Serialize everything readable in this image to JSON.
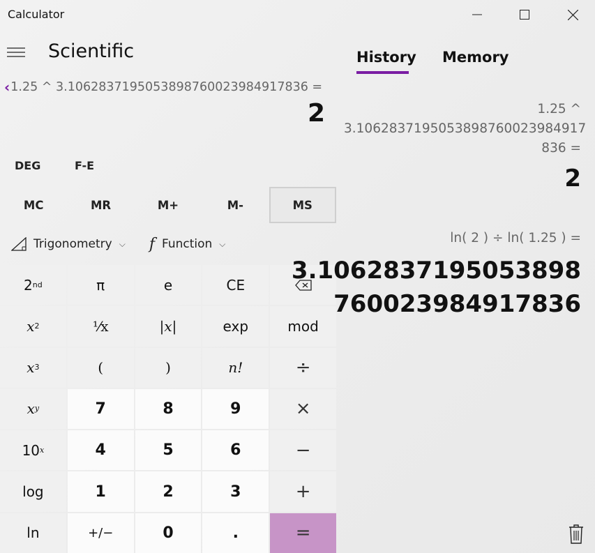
{
  "window": {
    "title": "Calculator"
  },
  "header": {
    "mode": "Scientific"
  },
  "display": {
    "expression": "1.25 ^ 3.1062837195053898760023984917836 =",
    "result": "2"
  },
  "toggles": {
    "angle": "DEG",
    "fe": "F-E"
  },
  "memory_row": [
    "MC",
    "MR",
    "M+",
    "M-",
    "MS"
  ],
  "function_row": {
    "trig_label": "Trigonometry",
    "func_label": "Function"
  },
  "keys": {
    "pi": "π",
    "e": "e",
    "ce": "CE",
    "reciprocal": "⅟x",
    "abs": "|x|",
    "exp": "exp",
    "mod": "mod",
    "lparen": "(",
    "rparen": ")",
    "factorial": "n!",
    "divide": "÷",
    "multiply": "×",
    "minus": "−",
    "plus": "+",
    "equals": "=",
    "log": "log",
    "ln": "ln",
    "negate": "+/−",
    "decimal": ".",
    "n7": "7",
    "n8": "8",
    "n9": "9",
    "n4": "4",
    "n5": "5",
    "n6": "6",
    "n1": "1",
    "n2": "2",
    "n3": "3",
    "n0": "0",
    "second": "2",
    "second_sup": "nd",
    "x_base": "x",
    "sq_sup": "2",
    "cube_sup": "3",
    "pow_sup": "y",
    "ten_base": "10",
    "ten_sup": "x"
  },
  "tabs": {
    "history": "History",
    "memory": "Memory"
  },
  "history": [
    {
      "expression_lines": [
        "1.25   ^",
        "3.1062837195053898760023984917",
        "836 ="
      ],
      "result": "2"
    },
    {
      "expression_lines": [
        "ln( 2 )   ÷   ln( 1.25 ) ="
      ],
      "result_lines": [
        "3.1062837195053898",
        "760023984917836"
      ]
    }
  ],
  "icons": {
    "back": "chevron-left-icon",
    "menu": "hamburger-icon",
    "trig": "triangle-ruler-icon",
    "func": "function-f-icon",
    "dropdown": "chevron-down-icon",
    "backspace": "backspace-icon",
    "delete_history": "trash-icon"
  },
  "colors": {
    "accent": "#7a1da3",
    "equals_key": "#c794c7"
  }
}
